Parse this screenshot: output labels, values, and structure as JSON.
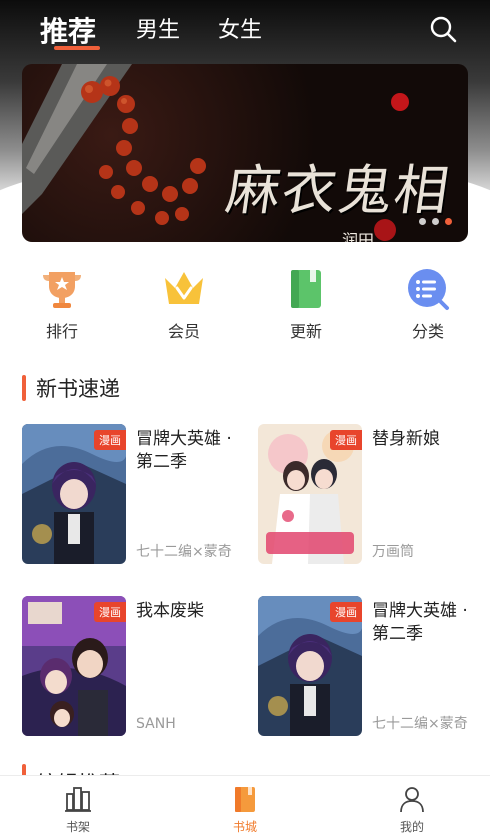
{
  "header": {
    "tabs": [
      {
        "label": "推荐",
        "active": true
      },
      {
        "label": "男生",
        "active": false
      },
      {
        "label": "女生",
        "active": false
      }
    ],
    "search_icon": "search-icon"
  },
  "banner": {
    "title": "麻衣鬼相",
    "subtitle": "润田",
    "page_count": 3,
    "active_index": 2
  },
  "entries": [
    {
      "label": "排行",
      "icon": "trophy-icon"
    },
    {
      "label": "会员",
      "icon": "crown-icon"
    },
    {
      "label": "更新",
      "icon": "book-icon"
    },
    {
      "label": "分类",
      "icon": "category-icon"
    }
  ],
  "section": {
    "title": "新书速递",
    "books": [
      {
        "title": "冒牌大英雄 · 第二季",
        "author": "七十二编×蒙奇",
        "tag": "漫画"
      },
      {
        "title": "替身新娘",
        "author": "万画筒",
        "tag": "漫画"
      },
      {
        "title": "我本废柴",
        "author": "SANH",
        "tag": "漫画"
      },
      {
        "title": "冒牌大英雄 · 第二季",
        "author": "七十二编×蒙奇",
        "tag": "漫画"
      }
    ]
  },
  "next_section": {
    "title": "编辑推荐"
  },
  "bottom_nav": [
    {
      "label": "书架",
      "icon": "bookshelf-icon",
      "active": false
    },
    {
      "label": "书城",
      "icon": "bookstore-icon",
      "active": true
    },
    {
      "label": "我的",
      "icon": "profile-icon",
      "active": false
    }
  ],
  "colors": {
    "accent": "#f0603a",
    "nav_active": "#f07a2a",
    "tag": "#e8452c"
  }
}
